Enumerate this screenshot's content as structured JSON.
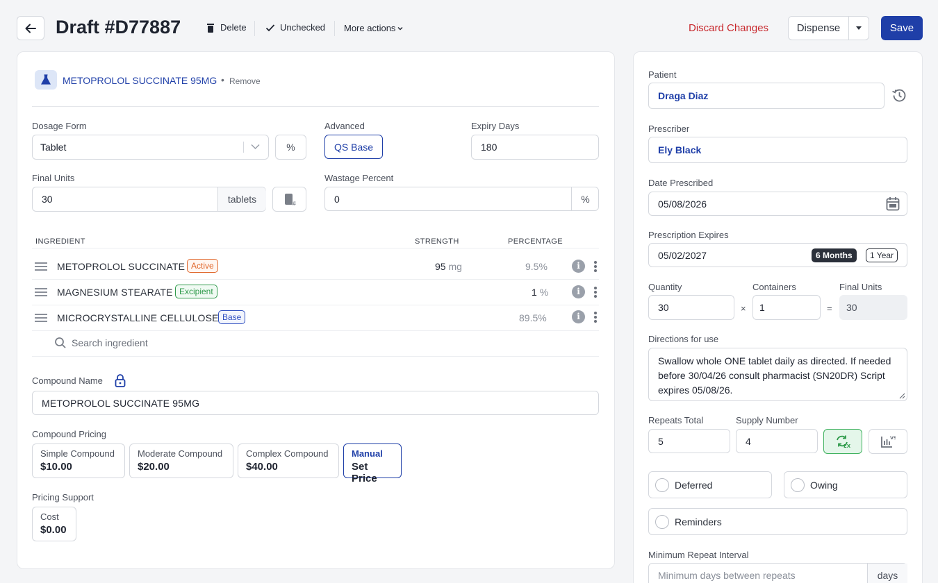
{
  "header": {
    "title": "Draft #D77887",
    "delete_label": "Delete",
    "unchecked_label": "Unchecked",
    "more_actions_label": "More actions",
    "discard_label": "Discard Changes",
    "dispense_label": "Dispense",
    "save_label": "Save"
  },
  "compound": {
    "product_name": "METOPROLOL SUCCINATE 95MG",
    "remove_label": "Remove",
    "dosage_form_label": "Dosage Form",
    "dosage_form_value": "Tablet",
    "percent_symbol": "%",
    "advanced_label": "Advanced",
    "qs_base_label": "QS Base",
    "expiry_days_label": "Expiry Days",
    "expiry_days_value": "180",
    "final_units_label": "Final Units",
    "final_units_value": "30",
    "final_units_unit": "tablets",
    "wastage_label": "Wastage Percent",
    "wastage_value": "0",
    "wastage_unit": "%"
  },
  "ingredients": {
    "headers": {
      "ingredient": "INGREDIENT",
      "strength": "STRENGTH",
      "percentage": "PERCENTAGE"
    },
    "rows": [
      {
        "name": "METOPROLOL SUCCINATE",
        "tag": "Active",
        "strength": "95",
        "strength_unit": "mg",
        "percentage": "9.5%"
      },
      {
        "name": "MAGNESIUM STEARATE",
        "tag": "Excipient",
        "strength": "1",
        "strength_unit": "%",
        "percentage": ""
      },
      {
        "name": "MICROCRYSTALLINE CELLULOSE",
        "tag": "Base",
        "strength": "",
        "strength_unit": "",
        "percentage": "89.5%"
      }
    ],
    "search_placeholder": "Search ingredient"
  },
  "compound_name": {
    "label": "Compound Name",
    "value": "METOPROLOL SUCCINATE 95MG"
  },
  "pricing": {
    "label": "Compound Pricing",
    "options": [
      {
        "title": "Simple Compound",
        "price": "$10.00"
      },
      {
        "title": "Moderate Compound",
        "price": "$20.00"
      },
      {
        "title": "Complex Compound",
        "price": "$40.00"
      },
      {
        "title": "Manual",
        "price": "Set Price"
      }
    ],
    "support_label": "Pricing Support",
    "cost_label": "Cost",
    "cost_value": "$0.00"
  },
  "prescription": {
    "patient_label": "Patient",
    "patient_value": "Draga Diaz",
    "prescriber_label": "Prescriber",
    "prescriber_value": "Ely Black",
    "date_prescribed_label": "Date Prescribed",
    "date_prescribed_value": "05/08/2026",
    "expires_label": "Prescription Expires",
    "expires_value": "05/02/2027",
    "expires_6m": "6 Months",
    "expires_1y": "1 Year",
    "quantity_label": "Quantity",
    "quantity_value": "30",
    "containers_label": "Containers",
    "containers_value": "1",
    "final_units_label": "Final Units",
    "final_units_value": "30",
    "times": "×",
    "equals": "=",
    "directions_label": "Directions for use",
    "directions_value": "Swallow whole ONE tablet daily as directed. If needed before 30/04/26 consult pharmacist (SN20DR) Script expires 05/08/26.",
    "repeats_label": "Repeats Total",
    "repeats_value": "5",
    "supply_label": "Supply Number",
    "supply_value": "4",
    "deferred_label": "Deferred",
    "owing_label": "Owing",
    "reminders_label": "Reminders",
    "min_interval_label": "Minimum Repeat Interval",
    "min_interval_placeholder": "Minimum days between repeats",
    "min_interval_unit": "days"
  },
  "colors": {
    "primary": "#1f3fa8",
    "danger": "#c8282d",
    "active_tag": "#e0662a",
    "excipient_tag": "#2e9a4a",
    "base_tag": "#2f4fc0"
  }
}
